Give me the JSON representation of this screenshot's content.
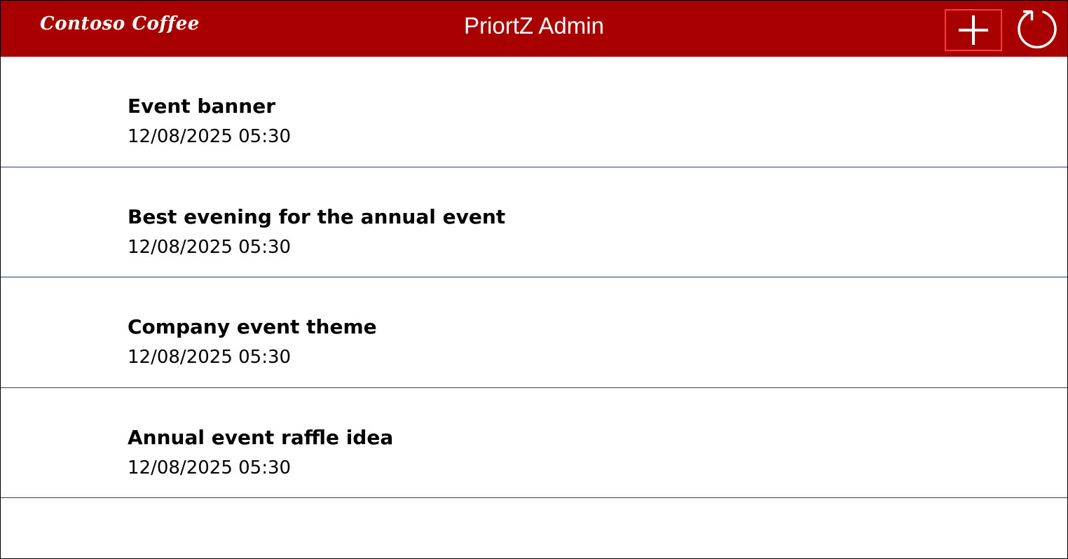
{
  "header": {
    "logo_text": "Contoso Coffee",
    "title": "PriortZ Admin",
    "add_icon": "plus-icon",
    "refresh_icon": "refresh-icon",
    "background_color": "#a80000",
    "add_border_color": "#ff3b3b"
  },
  "list": {
    "divider_color": "#2b3a8c",
    "items": [
      {
        "title": "Event banner",
        "date": "12/08/2025 05:30"
      },
      {
        "title": "Best evening for the annual event",
        "date": "12/08/2025 05:30"
      },
      {
        "title": "Company event theme",
        "date": "12/08/2025 05:30"
      },
      {
        "title": "Annual event raffle idea",
        "date": "12/08/2025 05:30"
      }
    ]
  }
}
